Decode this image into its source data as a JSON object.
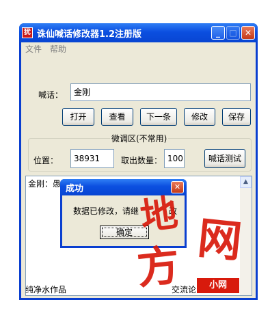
{
  "window": {
    "title": "诛仙喊话修改器1.2注册版",
    "icon_glyph": "犹",
    "buttons": {
      "minimize": "_",
      "maximize": "□",
      "close": "✕"
    }
  },
  "menu": [
    "文件",
    "帮助"
  ],
  "shout": {
    "label": "喊话：",
    "value": "金刚"
  },
  "toolbar": {
    "open": "打开",
    "view": "查看",
    "next": "下一条",
    "modify": "修改",
    "save": "保存"
  },
  "tuning": {
    "legend": "微调区(不常用)",
    "position_label": "位置：",
    "position_value": "38931",
    "count_label": "取出数量：",
    "count_value": "100",
    "test_button": "喊话测试"
  },
  "textarea": {
    "content": "金刚：愚蠢的女人，别动我的金刚!"
  },
  "status": {
    "left": "纯净水作品",
    "right": "交流论"
  },
  "dialog": {
    "title": "成功",
    "message": "数据已修改，请继",
    "message_tail": "改",
    "ok": "确定"
  },
  "watermark": {
    "chars": [
      "地",
      "网",
      "方"
    ],
    "box_text": "小网"
  },
  "colors": {
    "titlebar": "#0a3fd0",
    "client": "#ece9d8",
    "watermark": "#d81a0c"
  }
}
